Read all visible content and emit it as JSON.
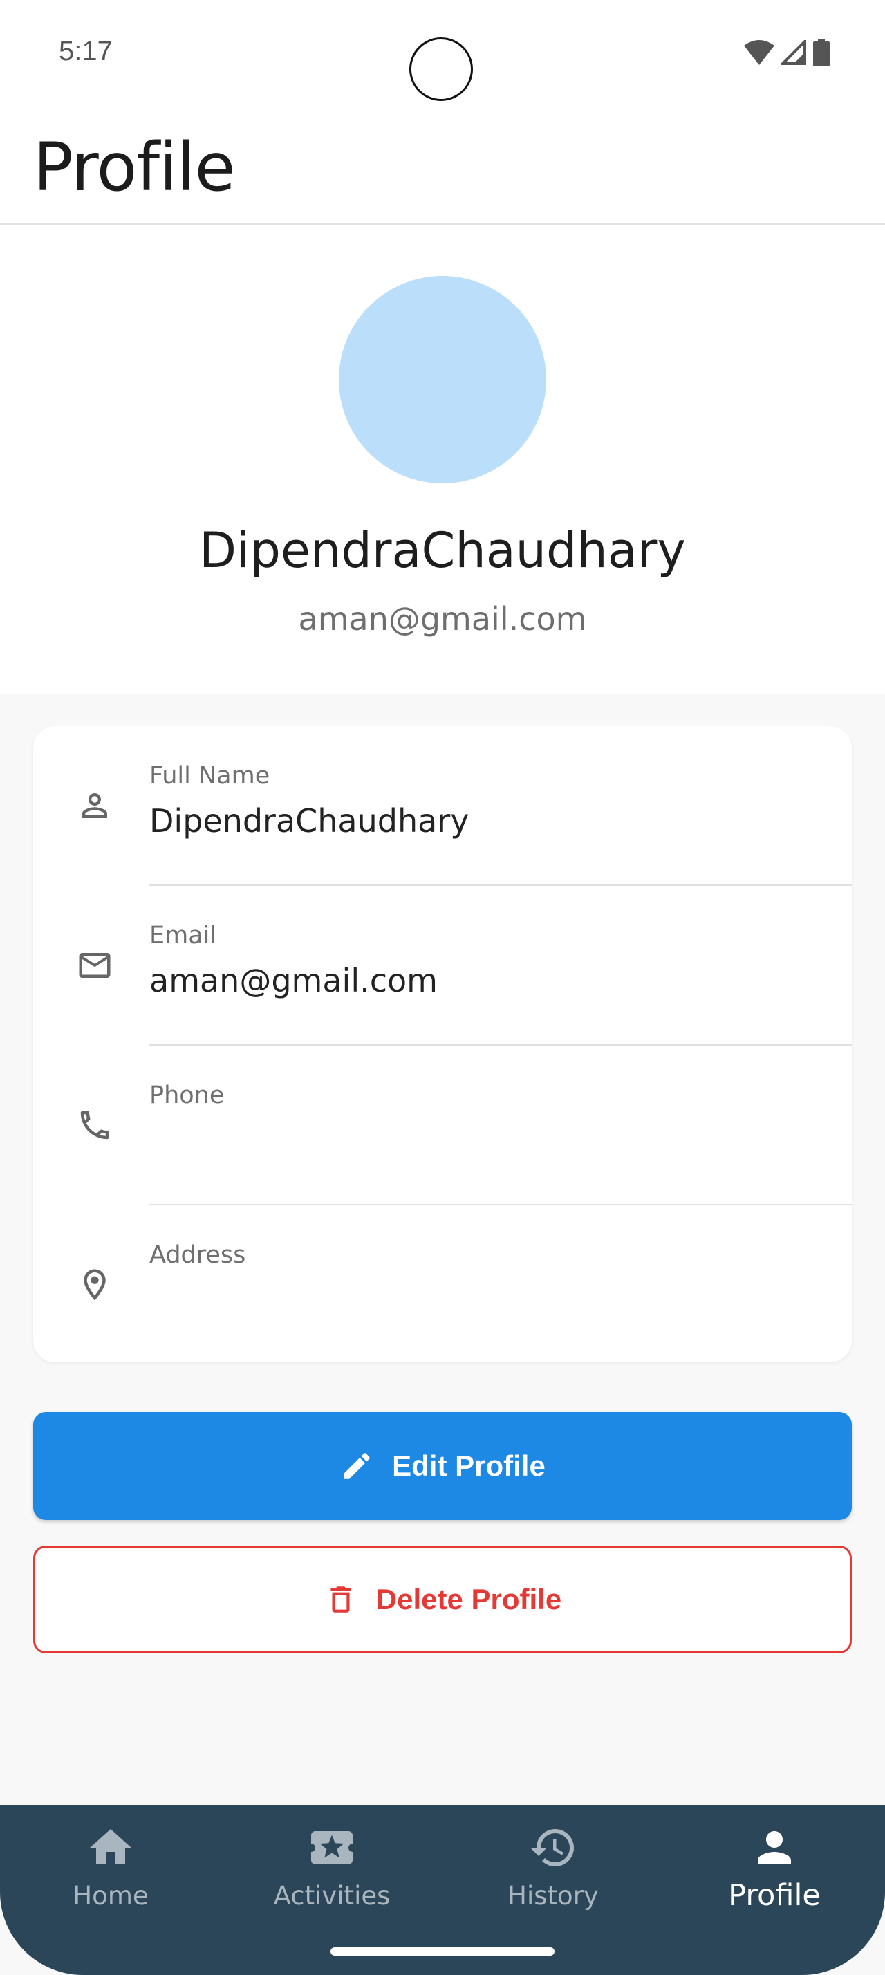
{
  "status_bar": {
    "time": "5:17"
  },
  "app_bar": {
    "title": "Profile"
  },
  "profile_header": {
    "name": "DipendraChaudhary",
    "email": "aman@gmail.com",
    "avatar_color": "#bbdefb"
  },
  "info_fields": [
    {
      "icon": "person-outline-icon",
      "label": "Full Name",
      "value": "DipendraChaudhary"
    },
    {
      "icon": "mail-outline-icon",
      "label": "Email",
      "value": "aman@gmail.com"
    },
    {
      "icon": "phone-icon",
      "label": "Phone",
      "value": ""
    },
    {
      "icon": "location-pin-icon",
      "label": "Address",
      "value": ""
    }
  ],
  "actions": {
    "edit_label": "Edit Profile",
    "delete_label": "Delete Profile"
  },
  "bottom_nav": {
    "items": [
      {
        "label": "Home",
        "icon": "home-icon"
      },
      {
        "label": "Activities",
        "icon": "ticket-star-icon"
      },
      {
        "label": "History",
        "icon": "history-icon"
      },
      {
        "label": "Profile",
        "icon": "person-icon",
        "active": true
      }
    ]
  },
  "colors": {
    "primary": "#1e88e5",
    "danger": "#e53935",
    "nav_background": "#2c4659"
  }
}
